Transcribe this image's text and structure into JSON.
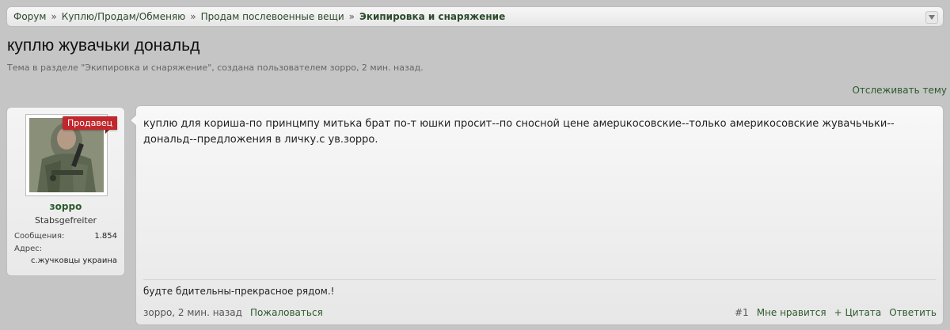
{
  "breadcrumb": {
    "items": [
      "Форум",
      "Куплю/Продам/Обменяю",
      "Продам послевоенные вещи",
      "Экипировка и снаряжение"
    ],
    "separator": "»"
  },
  "thread": {
    "title": "куплю жувачьки дональд",
    "description": "Тема в разделе \"Экипировка и снаряжение\", создана пользователем зорро, 2 мин. назад.",
    "watch_label": "Отслеживать тему"
  },
  "user": {
    "ribbon": "Продавец",
    "name": "зорро",
    "rank": "Stabsgefreiter",
    "messages_label": "Сообщения:",
    "messages_value": "1.854",
    "address_label": "Адрес:",
    "address_value": "с.жучковцы украина"
  },
  "post": {
    "message": "куплю для кориша-по принцмпу митька брат по-т юшки просит--по сносной цене амерuкосовские--только америкосовские жувачьчьки--дональд--предложения в личку.с ув.зорро.",
    "signature": "будте бдительны-прекрасное рядом.!",
    "author_time": "зорро, 2 мин. назад",
    "report_label": "Пожаловаться",
    "number": "#1",
    "like_label": "Мне нравится",
    "quote_label": "+ Цитата",
    "reply_label": "Ответить"
  },
  "colors": {
    "link": "#2d5a2d",
    "ribbon": "#c0282d",
    "background": "#c4c5c4"
  }
}
